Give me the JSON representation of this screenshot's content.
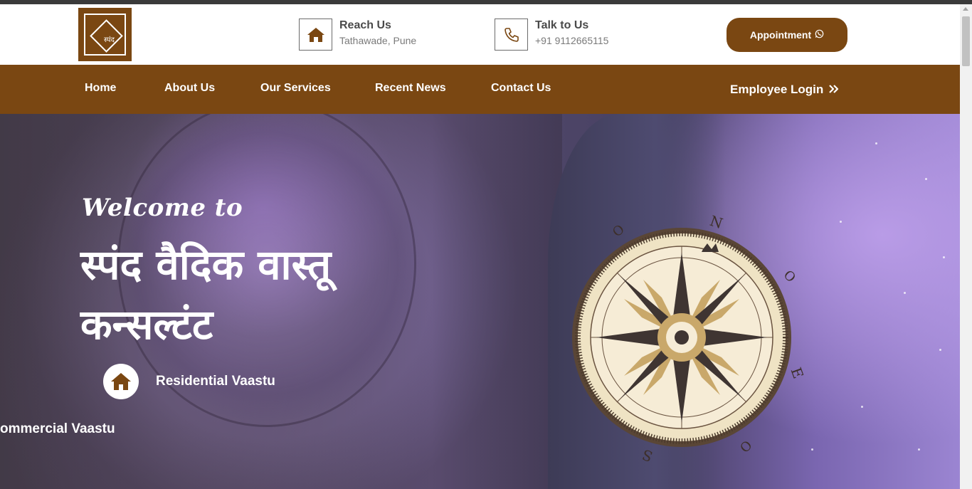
{
  "header": {
    "logo_text": "स्पंद",
    "reach": {
      "title": "Reach Us",
      "subtitle": "Tathawade, Pune",
      "icon": "home-icon"
    },
    "talk": {
      "title": "Talk to Us",
      "subtitle": "+91 9112665115",
      "icon": "phone-icon"
    },
    "appointment_label": "Appointment",
    "appointment_icon": "whatsapp-icon"
  },
  "nav": {
    "items": [
      "Home",
      "About Us",
      "Our Services",
      "Recent News",
      "Contact Us"
    ],
    "employee_login": "Employee Login",
    "employee_icon": "double-chevron-right-icon"
  },
  "hero": {
    "welcome": "Welcome to",
    "headline": "स्पंद वैदिक वास्तू कन्सल्टंट",
    "features": [
      {
        "label": "Residential Vaastu",
        "icon": "home-icon"
      },
      {
        "label": "ommercial Vaastu"
      }
    ],
    "compass_letters": [
      "N",
      "E",
      "S",
      "O",
      "O",
      "O"
    ]
  },
  "colors": {
    "brand": "#7a4712",
    "white": "#ffffff"
  }
}
